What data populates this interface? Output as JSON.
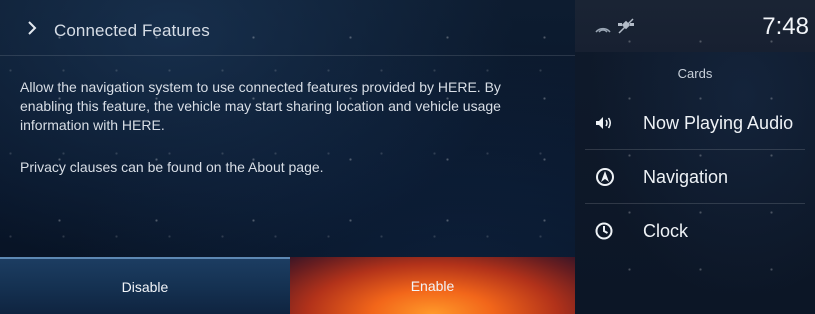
{
  "left_panel": {
    "header": {
      "chevron": "chevron-right-icon",
      "title": "Connected Features"
    },
    "description": "Allow the navigation system to use connected features provided by HERE. By enabling this feature, the vehicle may start sharing location and vehicle usage information with HERE.",
    "privacy_note": "Privacy clauses can be found on the About page.",
    "buttons": {
      "disable_label": "Disable",
      "enable_label": "Enable"
    }
  },
  "right_panel": {
    "status_bar": {
      "time": "7:48",
      "icons": [
        "signal-icon",
        "gps-off-icon"
      ]
    },
    "cards_title": "Cards",
    "cards": [
      {
        "icon": "speaker-icon",
        "label": "Now Playing Audio"
      },
      {
        "icon": "navigation-icon",
        "label": "Navigation"
      },
      {
        "icon": "clock-icon",
        "label": "Clock"
      }
    ]
  },
  "colors": {
    "accent_enable": "#f2661a",
    "accent_disable": "#1c3d62"
  }
}
